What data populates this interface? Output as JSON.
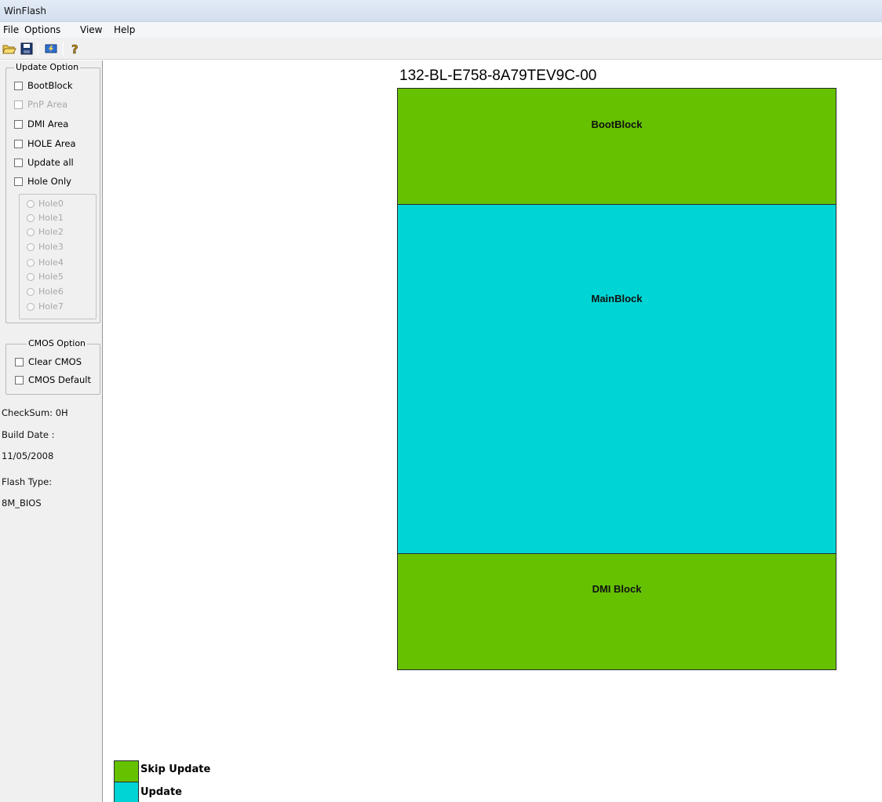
{
  "window": {
    "title": "WinFlash"
  },
  "menu": {
    "file": "File",
    "options": "Options",
    "view": "View",
    "help": "Help"
  },
  "toolbar": {
    "icons": [
      "open-folder-icon",
      "save-disk-icon",
      "flash-chip-icon",
      "help-question-icon"
    ]
  },
  "update_option": {
    "title": "Update Option",
    "checkboxes": [
      {
        "label": "BootBlock",
        "checked": false,
        "enabled": true
      },
      {
        "label": "PnP Area",
        "checked": false,
        "enabled": false
      },
      {
        "label": "DMI Area",
        "checked": false,
        "enabled": true
      },
      {
        "label": "HOLE Area",
        "checked": false,
        "enabled": true
      },
      {
        "label": "Update all",
        "checked": false,
        "enabled": true
      },
      {
        "label": "Hole Only",
        "checked": false,
        "enabled": true
      }
    ],
    "holes": [
      "Hole0",
      "Hole1",
      "Hole2",
      "Hole3",
      "Hole4",
      "Hole5",
      "Hole6",
      "Hole7"
    ]
  },
  "cmos_option": {
    "title": "CMOS Option",
    "checkboxes": [
      {
        "label": "Clear CMOS",
        "checked": false
      },
      {
        "label": "CMOS Default",
        "checked": false
      }
    ]
  },
  "info": {
    "checksum": "CheckSum: 0H",
    "build_date_label": "Build Date :",
    "build_date": "11/05/2008",
    "flash_type_label": "Flash Type:",
    "flash_type": "8M_BIOS"
  },
  "chip": {
    "title": "132-BL-E758-8A79TEV9C-00",
    "blocks": [
      {
        "label": "BootBlock",
        "status": "skip"
      },
      {
        "label": "MainBlock",
        "status": "update"
      },
      {
        "label": "DMI Block",
        "status": "skip"
      }
    ]
  },
  "legend": {
    "skip_label": "Skip Update",
    "update_label": "Update"
  },
  "colors": {
    "skip": "#66c200",
    "update": "#00d4d4"
  }
}
